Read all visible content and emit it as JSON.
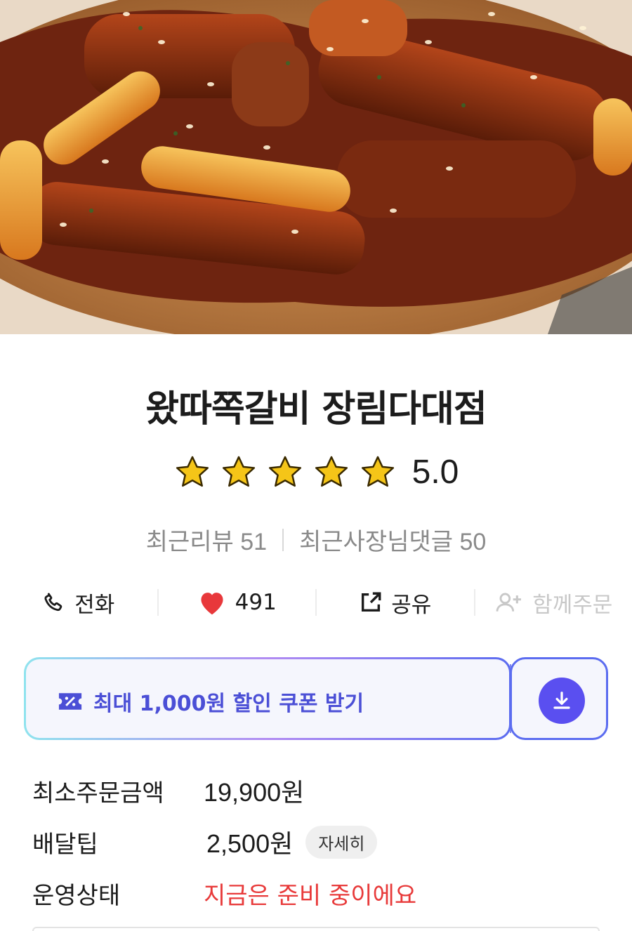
{
  "store": {
    "name": "왔따쪽갈비 장림다대점",
    "rating": "5.0",
    "star_count": 5,
    "star_color": "#f5c518",
    "recent_reviews": "최근리뷰 51",
    "recent_owner_comments": "최근사장님댓글 50"
  },
  "actions": {
    "call": {
      "label": "전화",
      "icon": "phone-icon"
    },
    "like": {
      "label": "491",
      "icon": "heart-icon",
      "color": "#e8383b"
    },
    "share": {
      "label": "공유",
      "icon": "share-icon"
    },
    "group_order": {
      "label": "함께주문",
      "icon": "add-user-icon",
      "enabled": false
    }
  },
  "coupon": {
    "text": "최대 1,000원 할인 쿠폰 받기",
    "icon": "coupon-icon",
    "download_icon": "download-icon",
    "accent": "#5a4ff0"
  },
  "info": {
    "min_order_label": "최소주문금액",
    "min_order_value": "19,900원",
    "delivery_tip_label": "배달팁",
    "delivery_tip_value": "2,500원",
    "detail_button": "자세히",
    "status_label": "운영상태",
    "status_value": "지금은 준비 중이에요",
    "status_color": "#e83a3a"
  }
}
